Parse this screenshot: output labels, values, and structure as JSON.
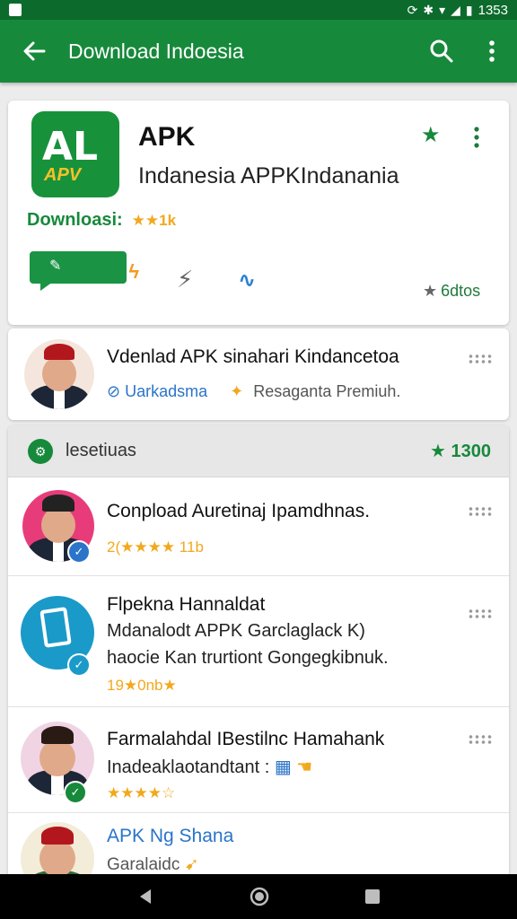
{
  "status_bar": {
    "time": "1353"
  },
  "app_bar": {
    "title": "Download Indoesia"
  },
  "app_card": {
    "logo_top": "AL",
    "logo_bottom": "APV",
    "name": "APK",
    "subtitle": "Indanesia APPKIndanania",
    "download_label": "Downloasi:",
    "download_rating": "★★1k",
    "grade_label": "6dtos"
  },
  "author_card": {
    "title": "Vdenlad APK sinahari Kindancetoa",
    "link_text": "Uarkadsma",
    "secondary_text": "Resaganta Premiuh."
  },
  "section": {
    "title": "lesetiuas",
    "count": "1300",
    "rows": [
      {
        "title": "Conpload Auretinaj Ipamdhnas.",
        "rating": "2(★★★★ 11b"
      },
      {
        "title": "Flpekna Hannaldat",
        "line2": "Mdanalodt APPK Garclaglack K)",
        "line3": "haocie Kan trurtiont Gongegkibnuk.",
        "rating": "19★0nb★"
      },
      {
        "title": "Farmalahdal IBestilnc Hamahank",
        "line2": "Inadeaklaotandtant :",
        "rating": "★★★★☆"
      },
      {
        "link": "APK Ng Shana",
        "sub": "Garalaidc"
      }
    ]
  },
  "colors": {
    "primary": "#17893b",
    "primary_dark": "#0c6b2c",
    "star": "#f2a81d",
    "link": "#2a74c9"
  }
}
